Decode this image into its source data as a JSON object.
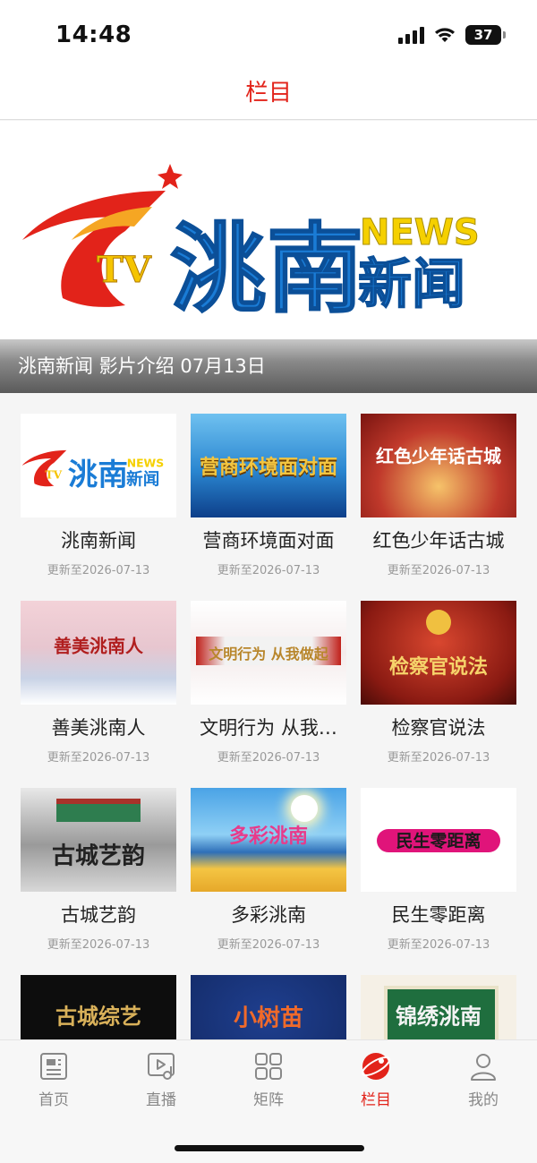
{
  "status": {
    "time": "14:48",
    "battery": "37"
  },
  "nav": {
    "title": "栏目"
  },
  "banner": {
    "logo_text": "洮南",
    "logo_news": "NEWS",
    "logo_xinwen": "新闻",
    "logo_tv": "TV",
    "caption": "洮南新闻 影片介绍 07月13日"
  },
  "items": [
    {
      "title": "洮南新闻",
      "date": "更新至2026-07-13"
    },
    {
      "title": "营商环境面对面",
      "date": "更新至2026-07-13",
      "thumb_text": "营商环境面对面"
    },
    {
      "title": "红色少年话古城",
      "date": "更新至2026-07-13",
      "thumb_text": "红色少年话古城"
    },
    {
      "title": "善美洮南人",
      "date": "更新至2026-07-13",
      "thumb_text": "善美洮南人"
    },
    {
      "title": "文明行为 从我…",
      "date": "更新至2026-07-13",
      "thumb_text": "文明行为 从我做起"
    },
    {
      "title": "检察官说法",
      "date": "更新至2026-07-13",
      "thumb_text": "检察官说法"
    },
    {
      "title": "古城艺韵",
      "date": "更新至2026-07-13",
      "thumb_text": "古城艺韵"
    },
    {
      "title": "多彩洮南",
      "date": "更新至2026-07-13",
      "thumb_text": "多彩洮南"
    },
    {
      "title": "民生零距离",
      "date": "更新至2026-07-13",
      "thumb_text": "民生零距离"
    },
    {
      "title": "",
      "date": "",
      "thumb_text": "古城综艺"
    },
    {
      "title": "",
      "date": "",
      "thumb_text": "小树苗"
    },
    {
      "title": "",
      "date": "",
      "thumb_text": "锦绣洮南"
    }
  ],
  "tabs": [
    {
      "label": "首页",
      "icon": "home-icon"
    },
    {
      "label": "直播",
      "icon": "live-icon"
    },
    {
      "label": "矩阵",
      "icon": "matrix-icon"
    },
    {
      "label": "栏目",
      "icon": "column-icon",
      "active": true
    },
    {
      "label": "我的",
      "icon": "profile-icon"
    }
  ],
  "colors": {
    "accent": "#e2231a",
    "blue": "#1a7cd6"
  }
}
